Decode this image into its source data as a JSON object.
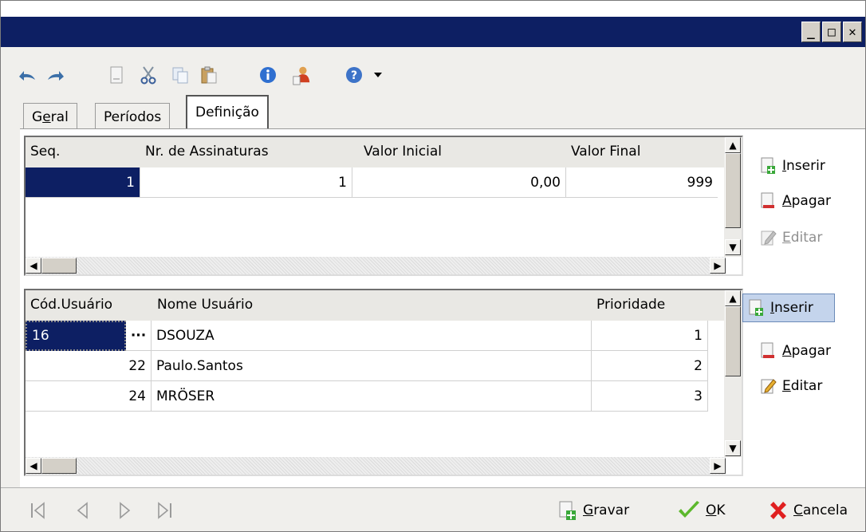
{
  "window": {
    "controls": [
      "_",
      "□",
      "✕"
    ]
  },
  "toolbar": {
    "icons": [
      "undo-icon",
      "redo-icon",
      "new-document-icon",
      "cut-icon",
      "copy-icon",
      "paste-icon",
      "info-icon",
      "user-icon",
      "help-icon",
      "dropdown-arrow-icon"
    ]
  },
  "tabs": [
    {
      "label": "Geral",
      "accel": "e"
    },
    {
      "label": "Períodos"
    },
    {
      "label": "Definição",
      "active": true
    }
  ],
  "grid1": {
    "headers": [
      "Seq.",
      "Nr. de Assinaturas",
      "Valor Inicial",
      "Valor Final"
    ],
    "rows": [
      {
        "seq": "1",
        "assinaturas": "1",
        "valor_inicial": "0,00",
        "valor_final": "999"
      }
    ]
  },
  "side1": {
    "inserir": {
      "accel": "I",
      "rest": "nserir"
    },
    "apagar": {
      "accel": "A",
      "rest": "pagar"
    },
    "editar": {
      "accel": "E",
      "rest": "ditar",
      "disabled": true
    }
  },
  "grid2": {
    "headers": [
      "Cód.Usuário",
      "Nome Usuário",
      "Prioridade"
    ],
    "rows": [
      {
        "cod": "16",
        "nome": "DSOUZA",
        "prioridade": "1"
      },
      {
        "cod": "22",
        "nome": "Paulo.Santos",
        "prioridade": "2"
      },
      {
        "cod": "24",
        "nome": "MRÖSER",
        "prioridade": "3"
      }
    ],
    "ellipsis": "···"
  },
  "side2": {
    "inserir": {
      "accel": "I",
      "rest": "nserir",
      "highlighted": true
    },
    "apagar": {
      "accel": "A",
      "rest": "pagar"
    },
    "editar": {
      "accel": "E",
      "rest": "ditar"
    }
  },
  "bottom": {
    "gravar": {
      "accel": "G",
      "rest": "ravar"
    },
    "ok": {
      "accel": "O",
      "rest": "K"
    },
    "cancela": {
      "accel": "C",
      "rest": "ancela"
    }
  },
  "colors": {
    "title": "#0d1f63",
    "selected": "#0d1f63",
    "highlight": "#c4d4ec"
  }
}
